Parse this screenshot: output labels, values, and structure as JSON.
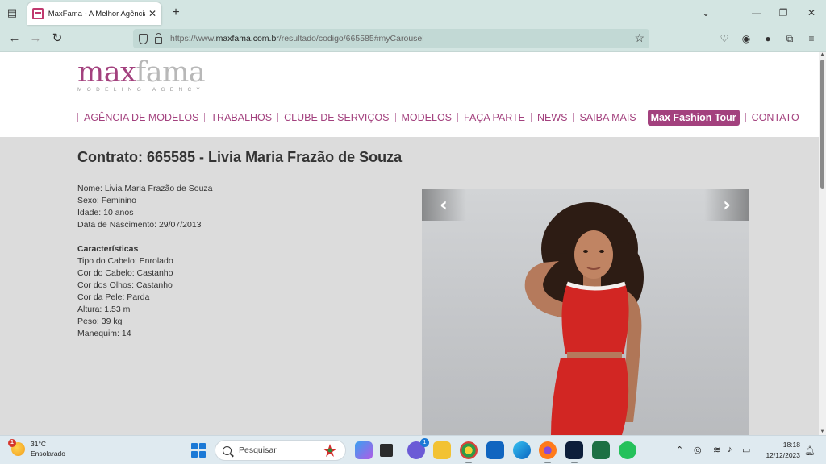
{
  "browser": {
    "tab_title": "MaxFama - A Melhor Agência d",
    "url_prefix": "https://www.",
    "url_host": "maxfama.com.br",
    "url_path": "/resultado/codigo/665585#myCarousel"
  },
  "site": {
    "logo_part1": "max",
    "logo_part2": "fama",
    "logo_tagline": "MODELING AGENCY",
    "menu": [
      {
        "label": "AGÊNCIA DE MODELOS"
      },
      {
        "label": "TRABALHOS"
      },
      {
        "label": "CLUBE DE SERVIÇOS"
      },
      {
        "label": "MODELOS"
      },
      {
        "label": "FAÇA PARTE"
      },
      {
        "label": "NEWS"
      },
      {
        "label": "SAIBA MAIS"
      },
      {
        "label": "Max Fashion Tour"
      },
      {
        "label": "CONTATO"
      }
    ],
    "accent_color": "#a3417e"
  },
  "contract": {
    "title": "Contrato: 665585 - Livia Maria Frazão de Souza",
    "nome": "Nome: Livia Maria Frazão de Souza",
    "sexo": "Sexo: Feminino",
    "idade": "Idade: 10 anos",
    "nascimento": "Data de Nascimento: 29/07/2013",
    "caracteristicas_heading": "Características",
    "cabelo_tipo": "Tipo do Cabelo: Enrolado",
    "cabelo_cor": "Cor do Cabelo: Castanho",
    "olhos_cor": "Cor dos Olhos: Castanho",
    "pele_cor": "Cor da Pele: Parda",
    "altura": "Altura: 1.53 m",
    "peso": "Peso: 39 kg",
    "manequim": "Manequim: 14"
  },
  "carousel": {
    "prev_icon": "‹",
    "next_icon": "›"
  },
  "taskbar": {
    "weather_temp": "31°C",
    "weather_desc": "Ensolarado",
    "weather_alert": "1",
    "search_placeholder": "Pesquisar",
    "chat_badge": "1",
    "time": "18:18",
    "date": "12/12/2023"
  }
}
